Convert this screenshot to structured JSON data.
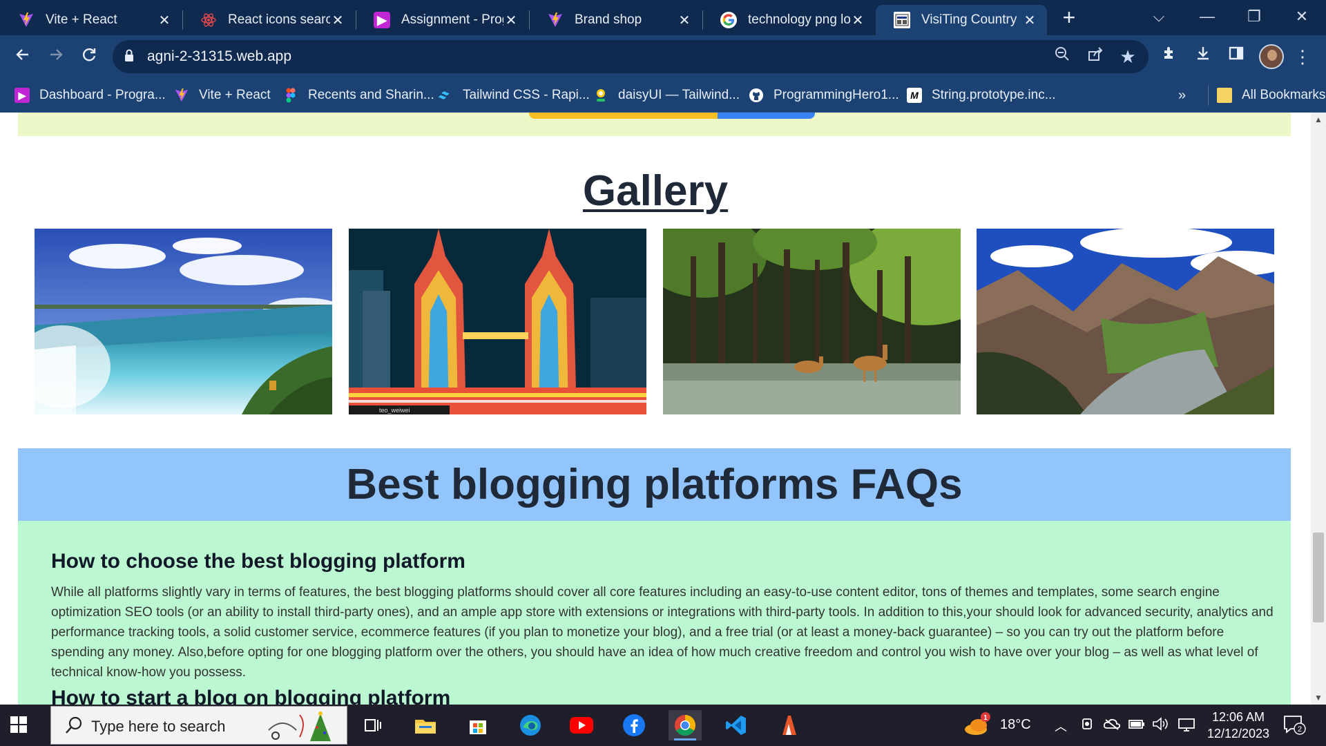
{
  "tabs": [
    {
      "title": "Vite + React",
      "favicon": "vite-icon"
    },
    {
      "title": "React icons search",
      "favicon": "react-icon"
    },
    {
      "title": "Assignment - Prog",
      "favicon": "programming-hero-icon"
    },
    {
      "title": "Brand shop",
      "favicon": "vite-icon"
    },
    {
      "title": "technology png lo",
      "favicon": "google-icon"
    },
    {
      "title": "VisiTing Country",
      "favicon": "site-icon",
      "active": true
    }
  ],
  "address_bar": {
    "url": "agni-2-31315.web.app"
  },
  "bookmarks": [
    {
      "label": "Dashboard - Progra...",
      "favicon": "programming-hero-icon"
    },
    {
      "label": "Vite + React",
      "favicon": "vite-icon"
    },
    {
      "label": "Recents and Sharin...",
      "favicon": "figma-icon"
    },
    {
      "label": "Tailwind CSS - Rapi...",
      "favicon": "tailwind-icon"
    },
    {
      "label": "daisyUI — Tailwind...",
      "favicon": "daisyui-icon"
    },
    {
      "label": "ProgrammingHero1...",
      "favicon": "github-icon"
    },
    {
      "label": "String.prototype.inc...",
      "favicon": "mdn-icon"
    }
  ],
  "bookmarks_overflow": "»",
  "all_bookmarks": "All Bookmarks",
  "page": {
    "gallery": {
      "title": "Gallery",
      "images": [
        {
          "alt": "waterfall",
          "caption": ""
        },
        {
          "alt": "twin towers at night",
          "caption": "teo_weiwei"
        },
        {
          "alt": "deer in mangrove forest",
          "caption": ""
        },
        {
          "alt": "mountain valley",
          "caption": ""
        }
      ]
    },
    "faq": {
      "heading": "Best blogging platforms FAQs",
      "items": [
        {
          "question": "How to choose the best blogging platform",
          "answer": "While all platforms slightly vary in terms of features, the best blogging platforms should cover all core features including an easy-to-use content editor, tons of themes and templates, some search engine optimization SEO tools (or an ability to install third-party ones), and an ample app store with extensions or integrations with third-party tools. In addition to this,your should look for advanced security, analytics and performance tracking tools, a solid customer service, ecommerce features (if you plan to monetize your blog), and a free trial (or at least a money-back guarantee) – so you can try out the platform before spending any money. Also,before opting for one blogging platform over the others, you should have an idea of how much creative freedom and control you wish to have over your blog – as well as what level of technical know-how you possess."
        },
        {
          "question": "How to start a blog on blogging platform"
        }
      ]
    }
  },
  "taskbar": {
    "search_placeholder": "Type here to search",
    "apps": [
      "task-view-icon",
      "file-explorer-icon",
      "microsoft-store-icon",
      "edge-icon",
      "youtube-icon",
      "facebook-icon",
      "chrome-icon",
      "vscode-icon",
      "app-icon"
    ],
    "weather": {
      "temp": "18°C",
      "badge": "1"
    },
    "clock": {
      "time": "12:06 AM",
      "date": "12/12/2023"
    },
    "notifications": "2"
  },
  "colors": {
    "tabbar": "#0f2a4e",
    "toolbar": "#1b4273",
    "faq_heading_bg": "#93c5fd",
    "faq_body_bg": "#bbf7d0",
    "banner_bg": "#ecf8c8"
  }
}
